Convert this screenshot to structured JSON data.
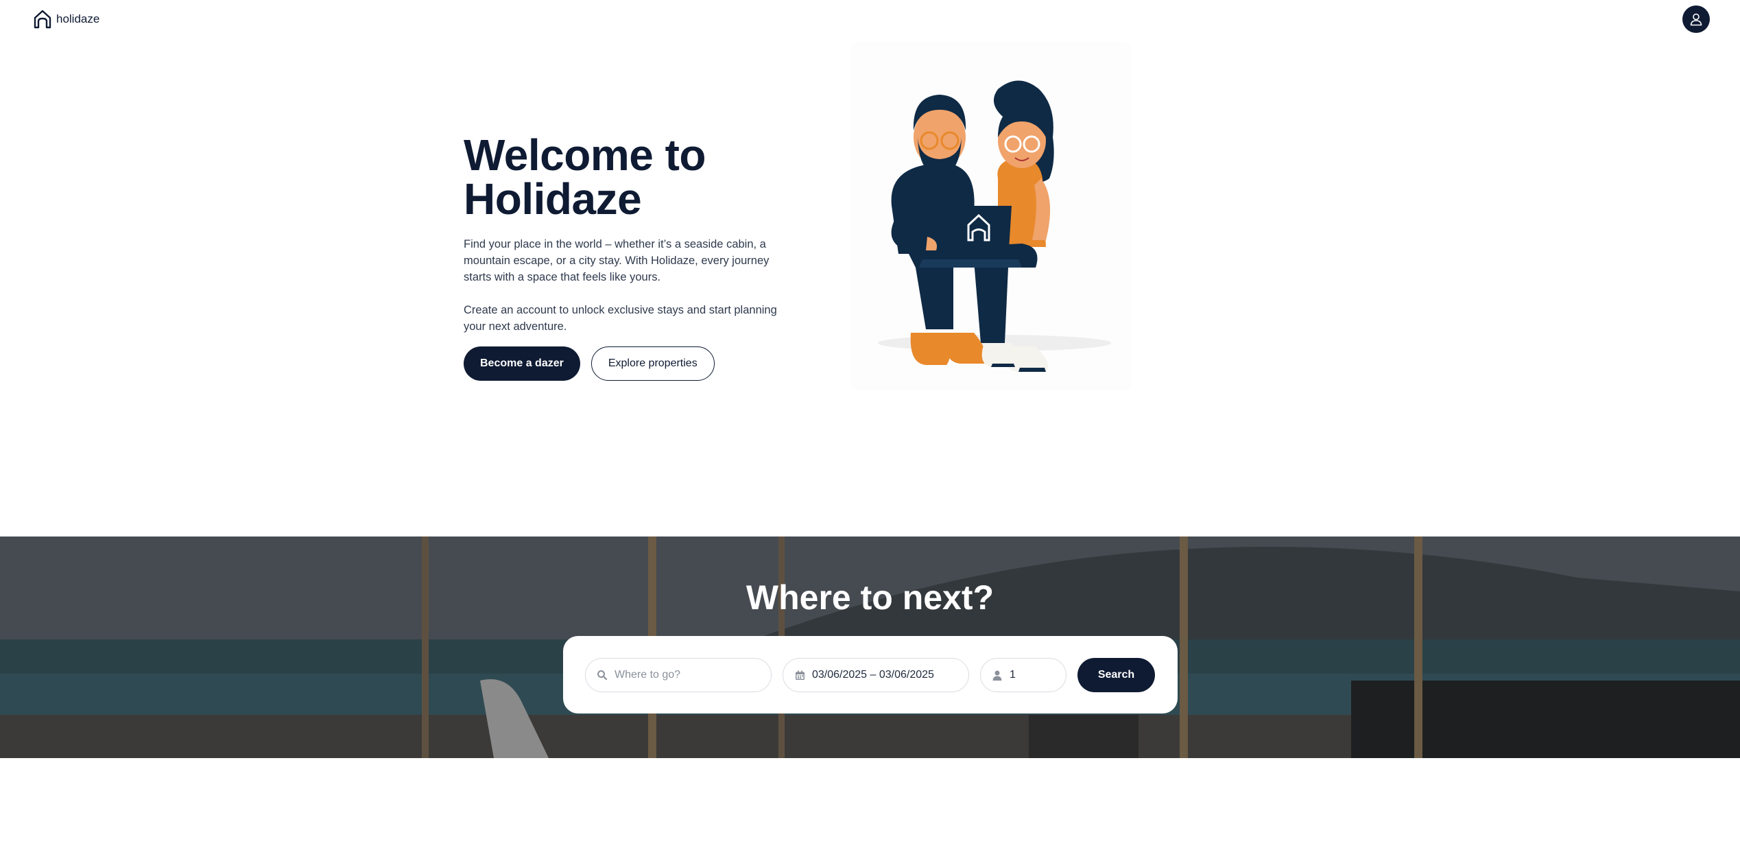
{
  "header": {
    "brand": "holidaze",
    "logo_icon": "house-outline-icon",
    "profile_icon": "user-icon"
  },
  "hero": {
    "title_line1": "Welcome to",
    "title_line2": "Holidaze",
    "paragraph1": "Find your place in the world – whether it’s a seaside cabin, a mountain escape, or a city stay. With Holidaze, every journey starts with a space that feels like yours.",
    "paragraph2": "Create an account to unlock exclusive stays and start planning your next adventure.",
    "primary_button": "Become a dazer",
    "secondary_button": "Explore properties",
    "illustration": "couple-with-laptop-illustration"
  },
  "search": {
    "heading": "Where to next?",
    "where_placeholder": "Where to go?",
    "dates_value": "03/06/2025 – 03/06/2025",
    "guests_value": "1",
    "search_button": "Search",
    "icons": [
      "search-icon",
      "calendar-icon",
      "person-icon"
    ]
  },
  "colors": {
    "primary": "#0f1b33",
    "background": "#ffffff",
    "accent_orange": "#e8892b"
  }
}
